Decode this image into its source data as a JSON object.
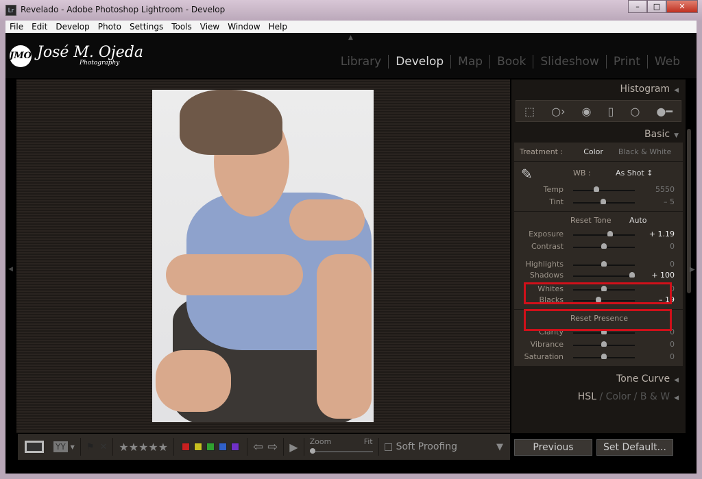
{
  "window": {
    "title": "Revelado - Adobe Photoshop Lightroom - Develop",
    "icon": "Lr",
    "min": "–",
    "max": "□",
    "close": "✕"
  },
  "menu": [
    "File",
    "Edit",
    "Develop",
    "Photo",
    "Settings",
    "Tools",
    "View",
    "Window",
    "Help"
  ],
  "logo": {
    "mark": "JMO",
    "name": "José M. Ojeda",
    "sub": "Photography"
  },
  "modules": [
    "Library",
    "Develop",
    "Map",
    "Book",
    "Slideshow",
    "Print",
    "Web"
  ],
  "active_module": "Develop",
  "panels": {
    "histogram": "Histogram",
    "basic": "Basic",
    "tone_curve": "Tone Curve",
    "hsl": "HSL",
    "color": "Color",
    "bw": "B & W"
  },
  "basic": {
    "treatment_label": "Treatment :",
    "treatment_color": "Color",
    "treatment_bw": "Black & White",
    "wb_label": "WB :",
    "wb_value": "As Shot ↕",
    "reset_tone": "Reset Tone",
    "auto": "Auto",
    "reset_presence": "Reset Presence",
    "sliders": [
      {
        "label": "Temp",
        "value": "5550",
        "pos": 0.38
      },
      {
        "label": "Tint",
        "value": "– 5",
        "pos": 0.49
      },
      {
        "label": "Exposure",
        "value": "+ 1.19",
        "pos": 0.6
      },
      {
        "label": "Contrast",
        "value": "0",
        "pos": 0.5
      },
      {
        "label": "Highlights",
        "value": "0",
        "pos": 0.5
      },
      {
        "label": "Shadows",
        "value": "+ 100",
        "pos": 0.95
      },
      {
        "label": "Whites",
        "value": "0",
        "pos": 0.5
      },
      {
        "label": "Blacks",
        "value": "– 19",
        "pos": 0.41
      },
      {
        "label": "Clarity",
        "value": "0",
        "pos": 0.5
      },
      {
        "label": "Vibrance",
        "value": "0",
        "pos": 0.5
      },
      {
        "label": "Saturation",
        "value": "0",
        "pos": 0.5
      }
    ]
  },
  "toolbar": {
    "stars": "★★★★★",
    "zoom": "Zoom",
    "fit": "Fit",
    "soft_proofing": "Soft Proofing",
    "labels": [
      "#c82020",
      "#c8c020",
      "#30a030",
      "#3060c8",
      "#7030c8"
    ]
  },
  "buttons": {
    "previous": "Previous",
    "set_default": "Set Default..."
  },
  "highlight_color": "#d0101a"
}
